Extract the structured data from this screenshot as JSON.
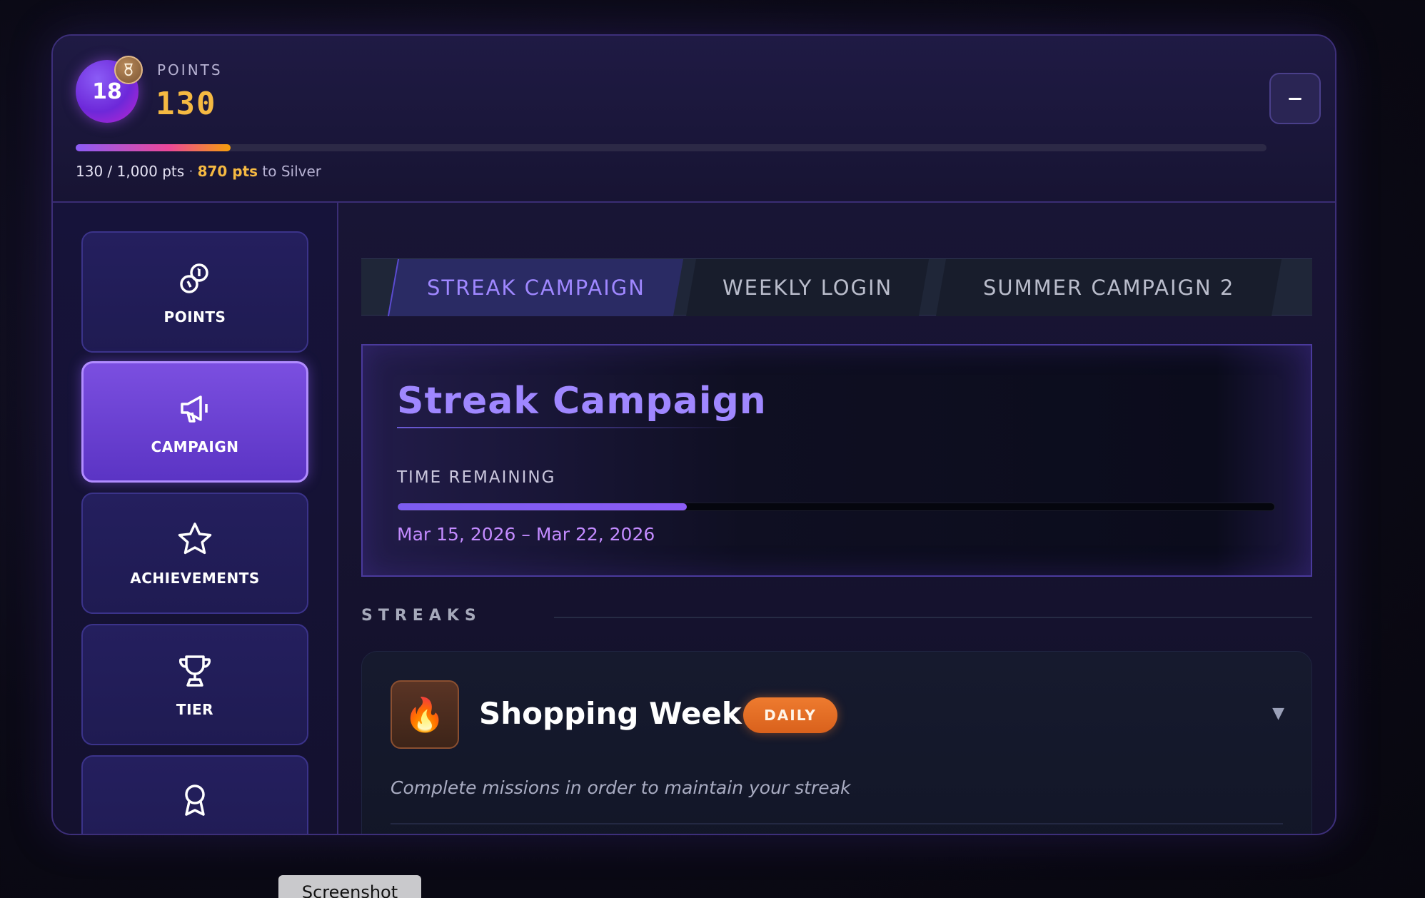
{
  "header": {
    "level": "18",
    "points_label": "POINTS",
    "points_value": "130",
    "progress_fraction": 0.13,
    "progress_current": "130 / 1,000 pts",
    "progress_separator": "·",
    "to_next_points": "870 pts",
    "to_next_suffix": "to Silver",
    "minimize_label": "–"
  },
  "sidebar": {
    "items": [
      {
        "label": "POINTS",
        "icon": "coins-icon",
        "active": false
      },
      {
        "label": "CAMPAIGN",
        "icon": "megaphone-icon",
        "active": true
      },
      {
        "label": "ACHIEVEMENTS",
        "icon": "star-icon",
        "active": false
      },
      {
        "label": "TIER",
        "icon": "trophy-icon",
        "active": false
      },
      {
        "label": "",
        "icon": "ribbon-icon",
        "active": false
      }
    ]
  },
  "tabs": [
    {
      "label": "STREAK CAMPAIGN",
      "active": true
    },
    {
      "label": "WEEKLY LOGIN",
      "active": false
    },
    {
      "label": "SUMMER CAMPAIGN 2",
      "active": false
    }
  ],
  "campaign": {
    "title": "Streak Campaign",
    "time_label": "TIME REMAINING",
    "time_fraction": 0.33,
    "date_range": "Mar 15, 2026 – Mar 22, 2026"
  },
  "streaks": {
    "section_title": "STREAKS",
    "items": [
      {
        "name": "Shopping Week",
        "badge": "DAILY",
        "icon": "fire-icon",
        "description": "Complete missions in order to maintain your streak"
      }
    ]
  },
  "screenshot_button": "Screenshot",
  "colors": {
    "accent": "#8b5cf6",
    "gold": "#f5b942",
    "daily_badge": "#ee7b2f",
    "date_text": "#c38bff"
  }
}
